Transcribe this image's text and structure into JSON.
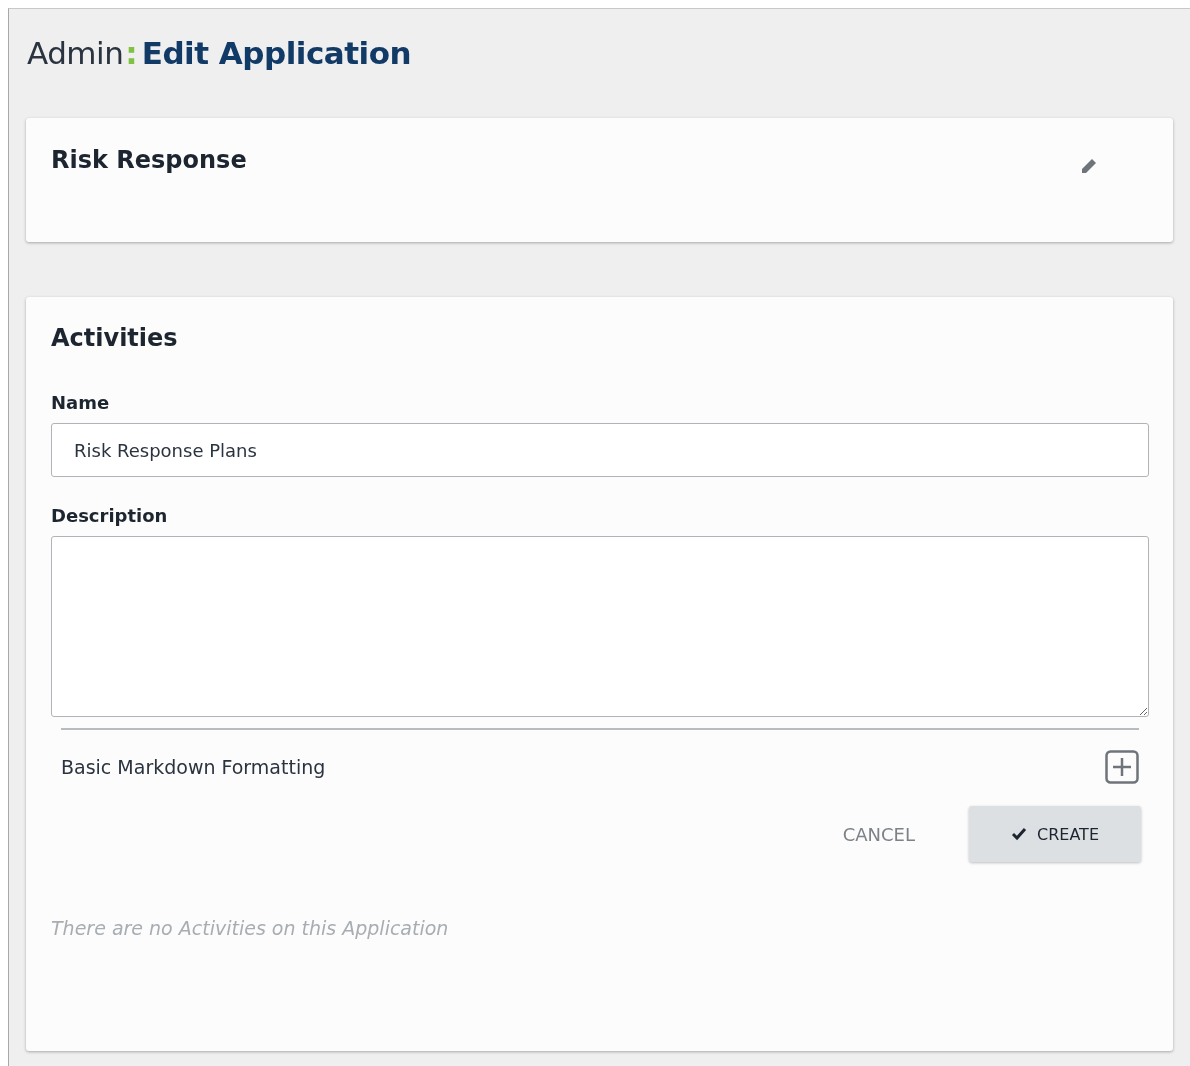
{
  "header": {
    "section": "Admin",
    "separator": ":",
    "title": "Edit Application"
  },
  "application": {
    "name": "Risk Response"
  },
  "activities": {
    "heading": "Activities",
    "name_field": {
      "label": "Name",
      "value": "Risk Response Plans"
    },
    "description_field": {
      "label": "Description"
    },
    "markdown": {
      "label": "Basic Markdown Formatting",
      "expanded": false
    },
    "buttons": [
      {
        "label": "CANCEL",
        "kind": "flat"
      },
      {
        "label": "CREATE",
        "kind": "primary"
      }
    ],
    "empty_message": "There are no Activities on this Application"
  }
}
